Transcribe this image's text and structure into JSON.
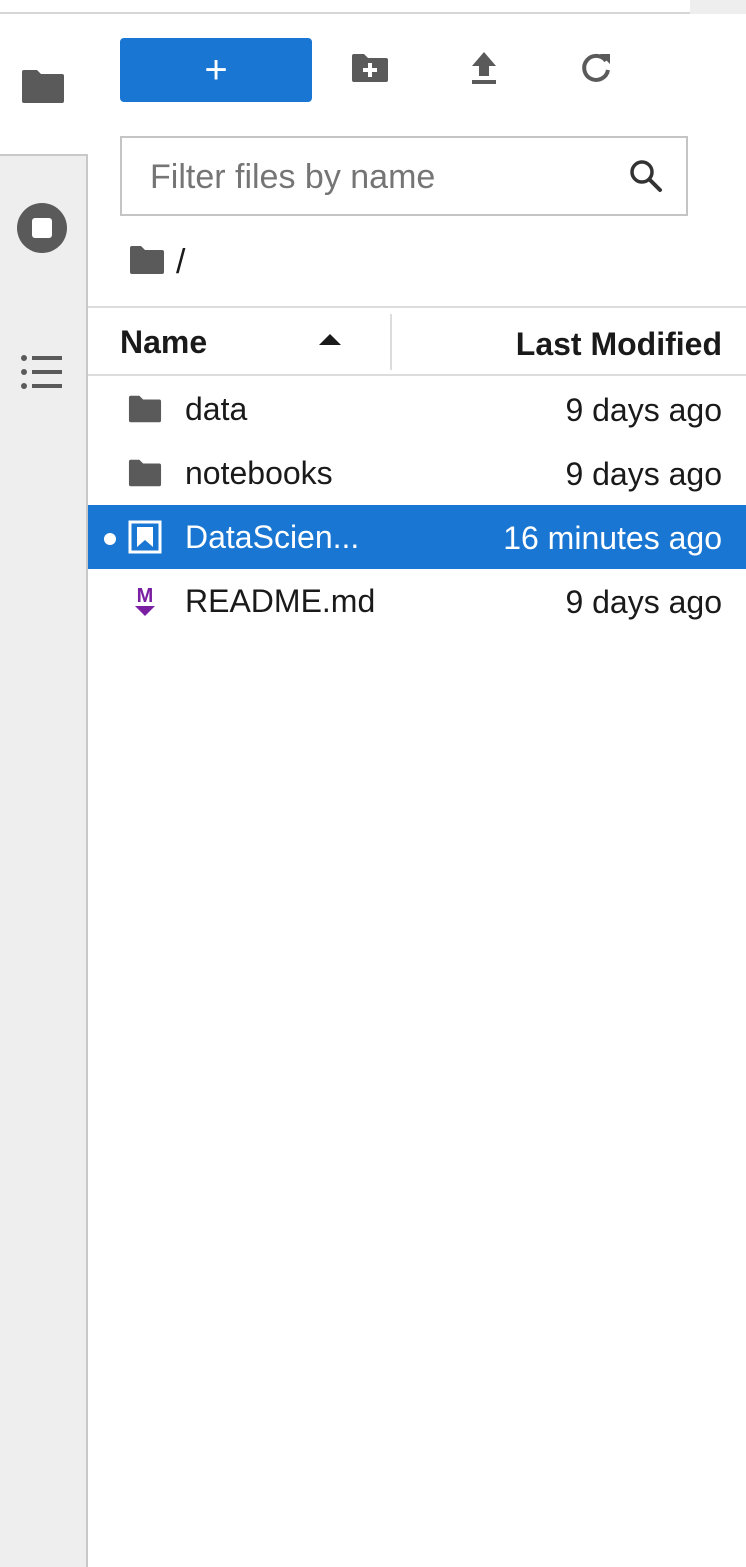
{
  "colors": {
    "accent": "#1976d2",
    "sidebar_bg": "#eeeeee",
    "icon_gray": "#5a5a5a",
    "markdown_purple": "#7b1fa2"
  },
  "activity_bar": {
    "items": [
      {
        "name": "file-browser",
        "icon": "folder-icon"
      },
      {
        "name": "running-sessions",
        "icon": "stop-circle-icon"
      },
      {
        "name": "table-of-contents",
        "icon": "list-icon"
      }
    ]
  },
  "toolbar": {
    "new_label": "+",
    "new_folder_icon": "new-folder-icon",
    "upload_icon": "upload-icon",
    "refresh_icon": "refresh-icon"
  },
  "filter": {
    "placeholder": "Filter files by name",
    "value": ""
  },
  "breadcrumb": {
    "path": "/"
  },
  "header": {
    "name": "Name",
    "last_modified": "Last Modified",
    "sort": "ascending"
  },
  "files": [
    {
      "name": "data",
      "modified": "9 days ago",
      "type": "folder"
    },
    {
      "name": "notebooks",
      "modified": "9 days ago",
      "type": "folder"
    },
    {
      "name": "DataScien...",
      "modified": "16 minutes ago",
      "type": "notebook",
      "selected": true,
      "running": true
    },
    {
      "name": "README.md",
      "modified": "9 days ago",
      "type": "markdown"
    }
  ]
}
